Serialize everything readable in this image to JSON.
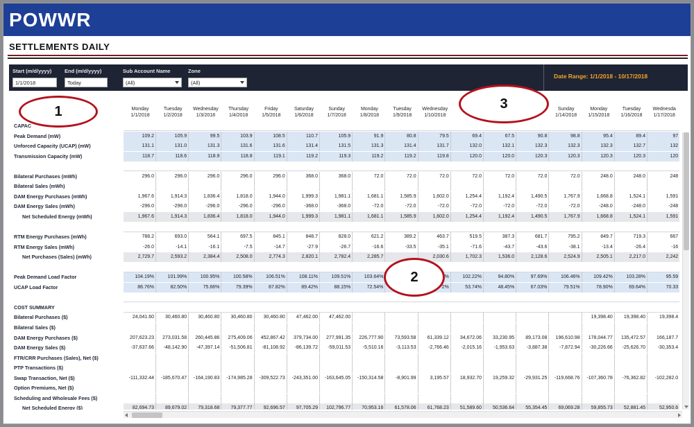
{
  "brand": {
    "logo_text": "POWWR"
  },
  "page": {
    "title": "SETTLEMENTS DAILY"
  },
  "filters": {
    "start_label": "Start (m/d/yyyy)",
    "start_value": "1/1/2018",
    "end_label": "End (m/d/yyyy)",
    "end_value": "Today",
    "subaccount_label": "Sub Account Name",
    "subaccount_value": "(All)",
    "zone_label": "Zone",
    "zone_value": "(All)",
    "date_range": "Date Range: 1/1/2018 - 10/17/2018"
  },
  "columns": [
    {
      "day": "Monday",
      "date": "1/1/2018"
    },
    {
      "day": "Tuesday",
      "date": "1/2/2018"
    },
    {
      "day": "Wednesday",
      "date": "1/3/2018"
    },
    {
      "day": "Thursday",
      "date": "1/4/2018"
    },
    {
      "day": "Friday",
      "date": "1/5/2018"
    },
    {
      "day": "Saturday",
      "date": "1/6/2018"
    },
    {
      "day": "Sunday",
      "date": "1/7/2018"
    },
    {
      "day": "Monday",
      "date": "1/8/2018"
    },
    {
      "day": "Tuesday",
      "date": "1/9/2018"
    },
    {
      "day": "Wednesday",
      "date": "1/10/2018"
    },
    {
      "day": "T",
      "date": ""
    },
    {
      "day": "",
      "date": ""
    },
    {
      "day": "",
      "date": ""
    },
    {
      "day": "Sunday",
      "date": "1/14/2018"
    },
    {
      "day": "Monday",
      "date": "1/15/2018"
    },
    {
      "day": "Tuesday",
      "date": "1/16/2018"
    },
    {
      "day": "Wednesda",
      "date": "1/17/2018"
    }
  ],
  "rows": [
    {
      "label": "CAPAC",
      "style": "section",
      "values": []
    },
    {
      "label": "Peak Demand (mW)",
      "style": "blue",
      "values": [
        "109.2",
        "105.9",
        "99.5",
        "103.9",
        "108.5",
        "110.7",
        "105.9",
        "91.9",
        "80.8",
        "79.5",
        "69.4",
        "67.5",
        "90.8",
        "98.8",
        "95.4",
        "89.4",
        "97"
      ]
    },
    {
      "label": "Unforced Capacity (UCAP) (mW)",
      "style": "blue",
      "values": [
        "131.1",
        "131.0",
        "131.3",
        "131.6",
        "131.6",
        "131.4",
        "131.5",
        "131.3",
        "131.4",
        "131.7",
        "132.0",
        "132.1",
        "132.3",
        "132.3",
        "132.3",
        "132.7",
        "132"
      ]
    },
    {
      "label": "Transmission Capacity (mW)",
      "style": "blue",
      "values": [
        "118.7",
        "118.6",
        "118.9",
        "118.8",
        "119.1",
        "119.2",
        "119.3",
        "119.2",
        "119.2",
        "119.8",
        "120.0",
        "120.0",
        "120.3",
        "120.3",
        "120.3",
        "120.3",
        "120"
      ]
    },
    {
      "label": "",
      "style": "blank",
      "values": []
    },
    {
      "label": "Bilateral Purchases (mWh)",
      "style": "white",
      "values": [
        "296.0",
        "296.0",
        "296.0",
        "296.0",
        "296.0",
        "368.0",
        "368.0",
        "72.0",
        "72.0",
        "72.0",
        "72.0",
        "72.0",
        "72.0",
        "72.0",
        "248.0",
        "248.0",
        "248"
      ]
    },
    {
      "label": "Bilateral Sales (mWh)",
      "style": "white",
      "values": []
    },
    {
      "label": "DAM Energy Purchases (mWh)",
      "style": "white",
      "values": [
        "1,967.6",
        "1,914.3",
        "1,836.4",
        "1,818.0",
        "1,944.0",
        "1,999.3",
        "1,981.1",
        "1,681.1",
        "1,585.9",
        "1,602.0",
        "1,254.4",
        "1,192.4",
        "1,490.5",
        "1,767.9",
        "1,668.8",
        "1,524.1",
        "1,591"
      ]
    },
    {
      "label": "DAM Energy Sales (mWh)",
      "style": "white",
      "values": [
        "-296.0",
        "-296.0",
        "-296.0",
        "-296.0",
        "-296.0",
        "-368.0",
        "-368.0",
        "-72.0",
        "-72.0",
        "-72.0",
        "-72.0",
        "-72.0",
        "-72.0",
        "-72.0",
        "-248.0",
        "-248.0",
        "-248"
      ]
    },
    {
      "label": "Net Scheduled Energy (mWh)",
      "style": "grey",
      "indent": true,
      "values": [
        "1,967.6",
        "1,914.3",
        "1,836.4",
        "1,818.0",
        "1,944.0",
        "1,999.3",
        "1,981.1",
        "1,681.1",
        "1,585.9",
        "1,602.0",
        "1,254.4",
        "1,192.4",
        "1,490.5",
        "1,767.9",
        "1,668.8",
        "1,524.1",
        "1,591"
      ]
    },
    {
      "label": "",
      "style": "blank",
      "values": []
    },
    {
      "label": "RTM Energy Purchases (mWh)",
      "style": "white",
      "values": [
        "788.2",
        "693.0",
        "564.1",
        "697.5",
        "845.1",
        "848.7",
        "828.0",
        "621.2",
        "389.2",
        "463.7",
        "519.5",
        "387.3",
        "681.7",
        "795.2",
        "849.7",
        "719.3",
        "667"
      ]
    },
    {
      "label": "RTM Energy Sales (mWh)",
      "style": "white",
      "values": [
        "-26.0",
        "-14.1",
        "-16.1",
        "-7.5",
        "-14.7",
        "-27.9",
        "-26.7",
        "-16.6",
        "-33.5",
        "-35.1",
        "-71.6",
        "-43.7",
        "-43.6",
        "-38.1",
        "-13.4",
        "-26.4",
        "-16"
      ]
    },
    {
      "label": "Net Purchases (Sales) (mWh)",
      "style": "grey",
      "indent": true,
      "values": [
        "2,729.7",
        "2,593.2",
        "2,384.4",
        "2,508.0",
        "2,774.3",
        "2,820.1",
        "2,782.4",
        "2,285.7",
        "",
        "2,030.6",
        "1,702.3",
        "1,536.0",
        "2,128.6",
        "2,524.9",
        "2,505.1",
        "2,217.0",
        "2,242"
      ]
    },
    {
      "label": "",
      "style": "blank",
      "values": []
    },
    {
      "label": "Peak Demand Load Factor",
      "style": "blue",
      "values": [
        "104.19%",
        "101.99%",
        "100.95%",
        "100.58%",
        "106.51%",
        "108.11%",
        "109.51%",
        "103.64%",
        "",
        "%",
        "102.22%",
        "94.80%",
        "97.69%",
        "106.46%",
        "109.42%",
        "103.28%",
        "95.59"
      ]
    },
    {
      "label": "UCAP Load Factor",
      "style": "blue",
      "values": [
        "86.76%",
        "82.50%",
        "75.66%",
        "79.39%",
        "87.82%",
        "89.42%",
        "88.15%",
        "72.54%",
        "",
        "2%",
        "53.74%",
        "48.45%",
        "67.03%",
        "79.51%",
        "78.90%",
        "69.64%",
        "70.33"
      ]
    },
    {
      "label": "",
      "style": "blank",
      "values": []
    },
    {
      "label": "COST SUMMARY",
      "style": "section",
      "values": []
    },
    {
      "label": "Bilateral Purchases ($)",
      "style": "white",
      "values": [
        "24,041.60",
        "30,460.80",
        "30,460.80",
        "30,460.80",
        "30,460.80",
        "47,462.00",
        "47,462.00",
        "",
        "",
        "",
        "",
        "",
        "",
        "",
        "19,398.40",
        "19,398.40",
        "19,398.4"
      ]
    },
    {
      "label": "Bilateral Sales ($)",
      "style": "white",
      "values": []
    },
    {
      "label": "DAM Energy Purchases ($)",
      "style": "white",
      "values": [
        "207,623.23",
        "273,031.58",
        "260,445.86",
        "275,409.06",
        "452,867.42",
        "379,734.00",
        "277,991.35",
        "226,777.90",
        "73,593.58",
        "61,339.12",
        "34,672.06",
        "33,230.95",
        "89,173.08",
        "196,610.98",
        "178,044.77",
        "135,472.57",
        "166,187.7"
      ]
    },
    {
      "label": "DAM Energy Sales ($)",
      "style": "white",
      "values": [
        "-37,637.66",
        "-48,142.90",
        "-47,397.14",
        "-51,506.81",
        "-81,108.92",
        "-86,139.72",
        "-59,011.53",
        "-5,510.16",
        "-3,113.53",
        "-2,766.46",
        "-2,015.16",
        "-1,953.63",
        "-3,887.38",
        "-7,872.94",
        "-30,226.66",
        "-25,626.70",
        "-30,353.4"
      ]
    },
    {
      "label": "FTR/CRR Purchases (Sales), Net ($)",
      "style": "white",
      "values": []
    },
    {
      "label": "PTP Transactions ($)",
      "style": "white",
      "values": []
    },
    {
      "label": "Swap Transaction, Net ($)",
      "style": "white",
      "values": [
        "-111,332.44",
        "-185,670.47",
        "-164,190.83",
        "-174,985.28",
        "-309,522.73",
        "-243,351.00",
        "-163,645.05",
        "-150,314.58",
        "-8,901.99",
        "3,195.57",
        "18,932.70",
        "19,259.32",
        "-29,931.25",
        "-119,668.76",
        "-107,360.78",
        "-76,362.82",
        "-102,282.0"
      ]
    },
    {
      "label": "Option Premiums, Net ($)",
      "style": "white",
      "values": []
    },
    {
      "label": "Scheduling and Wholesale Fees ($)",
      "style": "white",
      "values": []
    },
    {
      "label": "Net Scheduled Energy ($)",
      "style": "grey",
      "indent": true,
      "values": [
        "82,694.73",
        "89,679.02",
        "79,318.68",
        "79,377.77",
        "92,696.57",
        "97,705.29",
        "102,796.77",
        "70,953.16",
        "61,578.06",
        "61,768.23",
        "51,589.60",
        "50,536.64",
        "55,354.45",
        "69,069.28",
        "59,855.73",
        "52,881.45",
        "52,950.6"
      ]
    }
  ],
  "annotations": [
    "1",
    "2",
    "3"
  ]
}
